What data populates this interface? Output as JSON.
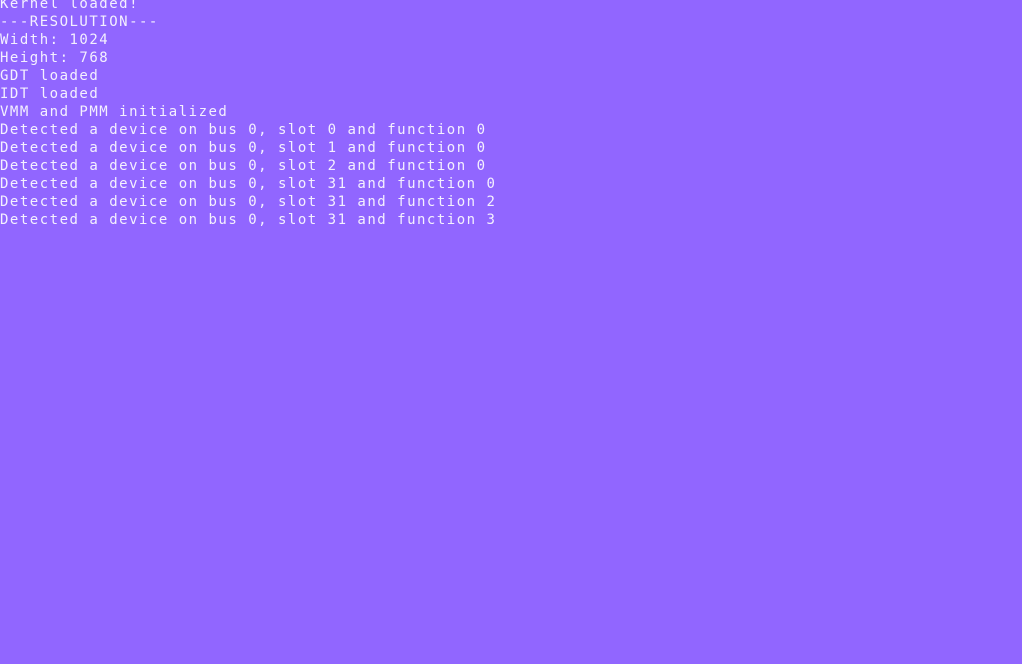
{
  "screen": {
    "background_color": "#9166ff",
    "text_color": "#f4f0ff"
  },
  "console": {
    "lines": [
      "Kernel loaded!",
      "---RESOLUTION---",
      "Width: 1024",
      "Height: 768",
      "GDT loaded",
      "IDT loaded",
      "VMM and PMM initialized",
      "Detected a device on bus 0, slot 0 and function 0",
      "Detected a device on bus 0, slot 1 and function 0",
      "Detected a device on bus 0, slot 2 and function 0",
      "Detected a device on bus 0, slot 31 and function 0",
      "Detected a device on bus 0, slot 31 and function 2",
      "Detected a device on bus 0, slot 31 and function 3"
    ]
  }
}
